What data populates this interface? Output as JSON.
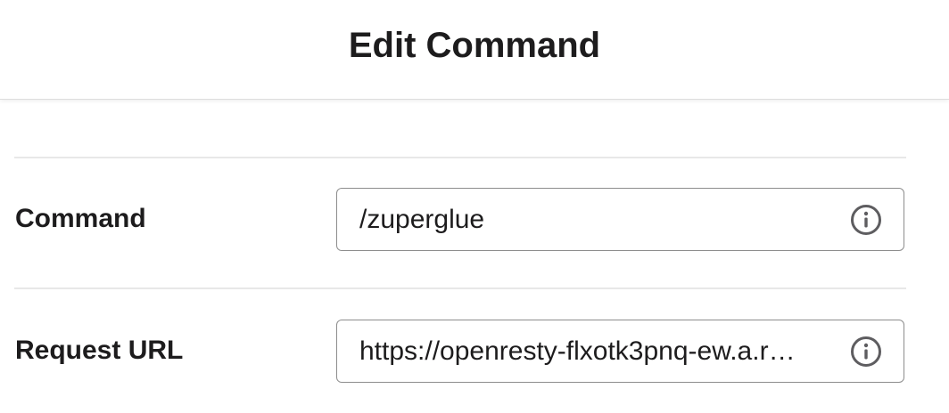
{
  "dialog": {
    "title": "Edit Command"
  },
  "form": {
    "command": {
      "label": "Command",
      "value": "/zuperglue",
      "icon": "info-icon"
    },
    "request_url": {
      "label": "Request URL",
      "value": "https://openresty-flxotk3pnq-ew.a.r…",
      "icon": "info-icon"
    }
  },
  "colors": {
    "text": "#1d1c1d",
    "field_border": "#8d8d8d",
    "divider": "#e8e8e8"
  }
}
